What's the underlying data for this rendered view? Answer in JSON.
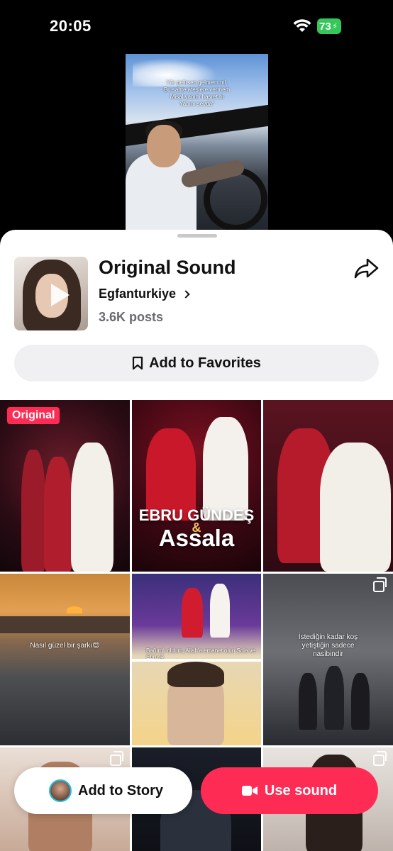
{
  "status_bar": {
    "time": "20:05",
    "battery": "73"
  },
  "video_preview": {
    "caption": "Yâr gelirsen gelmem mi,\nBu sahte ateşlere vermem\nMisal yanım hasret bi\nYanım sevda\""
  },
  "sound": {
    "title": "Original Sound",
    "author": "Egfanturkiye",
    "posts": "3.6K posts"
  },
  "favorites_label": "Add to Favorites",
  "grid": {
    "original_badge": "Original",
    "tile2_line1": "EBRU GÜNDEŞ",
    "tile2_amp": "&",
    "tile2_line2": "Assala",
    "tile4_caption": "Nasıl güzel bir şarkı😊",
    "tile5_caption": "Bağımlı oldum, Allah'a emanet olun Sola ve Ebru😘",
    "tile6_caption": "İstediğin kadar koş\nyetiştiğin sadece\nnasibindir"
  },
  "buttons": {
    "add_to_story": "Add to Story",
    "use_sound": "Use sound"
  },
  "colors": {
    "accent": "#fe2c55",
    "battery": "#34c759"
  }
}
